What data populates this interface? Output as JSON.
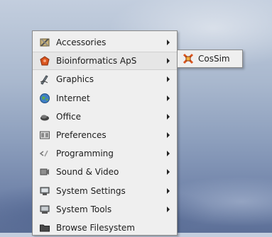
{
  "menu": {
    "items": [
      {
        "label": "Accessories",
        "icon": "accessories-icon",
        "has_submenu": true
      },
      {
        "label": "Bioinformatics ApS",
        "icon": "bioinformatics-icon",
        "has_submenu": true
      },
      {
        "label": "Graphics",
        "icon": "graphics-icon",
        "has_submenu": true
      },
      {
        "label": "Internet",
        "icon": "internet-icon",
        "has_submenu": true
      },
      {
        "label": "Office",
        "icon": "office-icon",
        "has_submenu": true
      },
      {
        "label": "Preferences",
        "icon": "preferences-icon",
        "has_submenu": true
      },
      {
        "label": "Programming",
        "icon": "programming-icon",
        "has_submenu": true
      },
      {
        "label": "Sound & Video",
        "icon": "sound-video-icon",
        "has_submenu": true
      },
      {
        "label": "System Settings",
        "icon": "system-settings-icon",
        "has_submenu": true
      },
      {
        "label": "System Tools",
        "icon": "system-tools-icon",
        "has_submenu": true
      },
      {
        "label": "Browse Filesystem",
        "icon": "folder-icon",
        "has_submenu": false
      }
    ],
    "selected": "Bioinformatics ApS"
  },
  "submenu": {
    "items": [
      {
        "label": "CosSim",
        "icon": "cossim-icon"
      }
    ]
  },
  "colors": {
    "menu_bg": "#efefef",
    "selected_bg": "#e6e6e6",
    "accent_orange": "#d9541e"
  }
}
